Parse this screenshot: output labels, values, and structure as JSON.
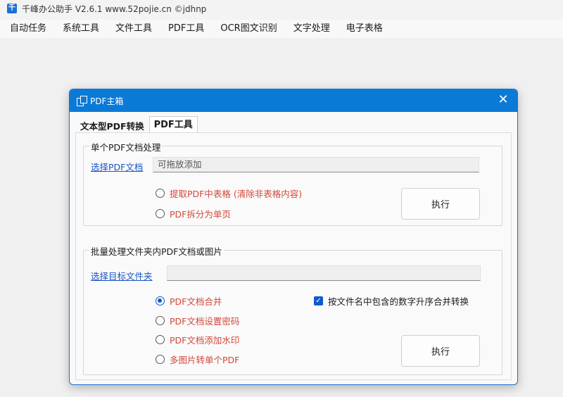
{
  "app": {
    "title": "千峰办公助手 V2.6.1  www.52pojie.cn ©jdhnp",
    "icon_glyph": "千"
  },
  "menu": [
    "自动任务",
    "系统工具",
    "文件工具",
    "PDF工具",
    "OCR图文识别",
    "文字处理",
    "电子表格"
  ],
  "dialog": {
    "title": "PDF主箱",
    "close": "✕",
    "tabs": [
      {
        "label": "文本型PDF转换",
        "active": false
      },
      {
        "label": "PDF工具",
        "active": true
      }
    ],
    "single": {
      "group_title": "单个PDF文档处理",
      "select_link": "选择PDF文档",
      "input_placeholder": "可拖放添加",
      "options": [
        {
          "label": "提取PDF中表格 (清除非表格内容)",
          "checked": false
        },
        {
          "label": "PDF拆分为单页",
          "checked": false
        }
      ],
      "execute_label": "执行"
    },
    "batch": {
      "group_title": "批量处理文件夹内PDF文档或图片",
      "select_link": "选择目标文件夹",
      "input_value": "",
      "options": [
        {
          "label": "PDF文档合并",
          "checked": true
        },
        {
          "label": "PDF文档设置密码",
          "checked": false
        },
        {
          "label": "PDF文档添加水印",
          "checked": false
        },
        {
          "label": "多图片转单个PDF",
          "checked": false
        }
      ],
      "sort_checkbox_label": "按文件名中包含的数字升序合并转换",
      "sort_checkbox_checked": true,
      "execute_label": "执行"
    }
  },
  "colors": {
    "accent": "#0a7ad6",
    "option_text": "#d4473a",
    "link": "#1a54c4"
  }
}
